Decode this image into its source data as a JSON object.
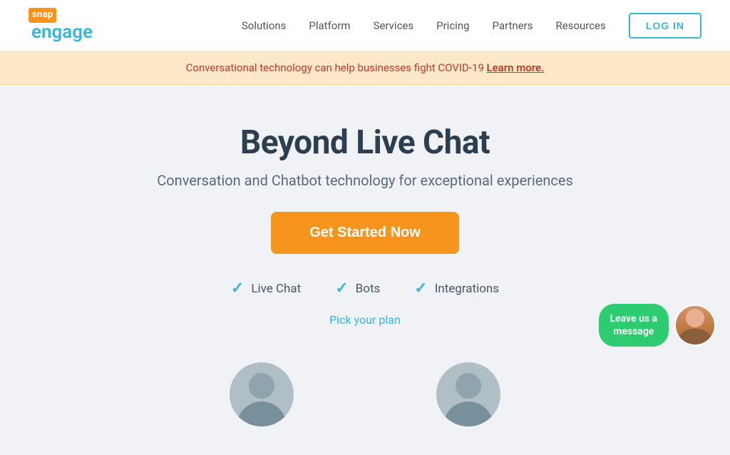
{
  "header": {
    "logo": {
      "snap": "snap",
      "engage": "engage"
    },
    "nav": {
      "items": [
        {
          "label": "Solutions",
          "id": "solutions"
        },
        {
          "label": "Platform",
          "id": "platform"
        },
        {
          "label": "Services",
          "id": "services"
        },
        {
          "label": "Pricing",
          "id": "pricing"
        },
        {
          "label": "Partners",
          "id": "partners"
        },
        {
          "label": "Resources",
          "id": "resources"
        }
      ],
      "login_label": "LOG IN"
    }
  },
  "banner": {
    "text": "Conversational technology can help businesses fight COVID-19 ",
    "link_text": "Learn more."
  },
  "hero": {
    "title": "Beyond Live Chat",
    "subtitle": "Conversation and Chatbot technology for exceptional experiences",
    "cta_label": "Get Started Now",
    "features": [
      {
        "label": "Live Chat"
      },
      {
        "label": "Bots"
      },
      {
        "label": "Integrations"
      }
    ],
    "pick_plan": "Pick your plan"
  },
  "widget": {
    "leave_message_line1": "Leave us a",
    "leave_message_line2": "message"
  },
  "colors": {
    "orange": "#f7941d",
    "blue": "#3ab4d8",
    "green": "#2ecc71",
    "dark_text": "#2c3e50",
    "mid_text": "#5a6a7a"
  }
}
